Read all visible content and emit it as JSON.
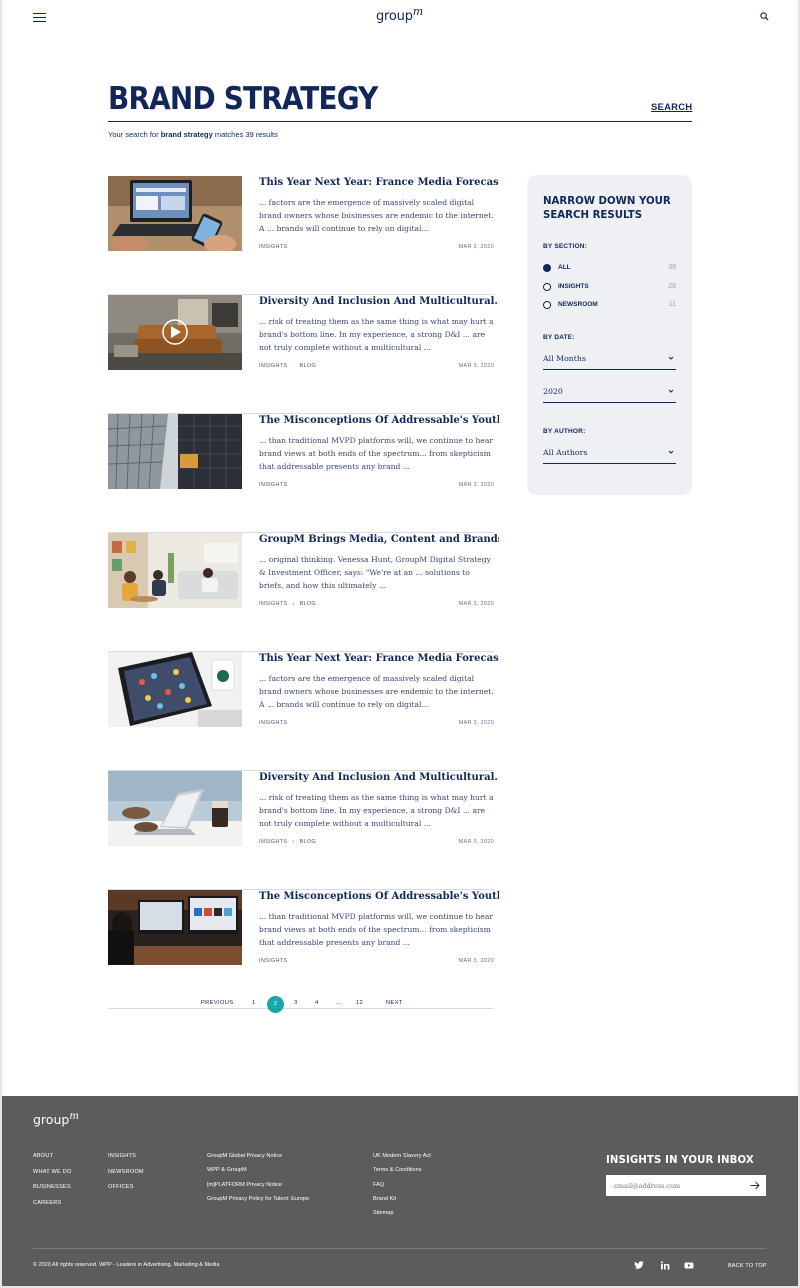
{
  "header": {
    "logo_text": "group",
    "logo_mark": "m"
  },
  "search": {
    "title": "BRAND STRATEGY",
    "search_link": "SEARCH",
    "result_prefix": "Your search for",
    "query": "brand strategy",
    "result_suffix": "matches 39 results"
  },
  "articles": [
    {
      "title": "This Year Next Year: France Media Forecasts",
      "excerpt": "... factors are the emergence of massively scaled digital brand owners whose businesses are endemic to the internet. A ... brands will continue to rely on digital...",
      "tags": [
        "INSIGHTS"
      ],
      "date": "MAR 3, 2020",
      "image": "laptop-phone-photo"
    },
    {
      "title": "Diversity And Inclusion And Multicultural...",
      "excerpt": "... risk of treating them as the same thing is what may hurt a brand's bottom line. In my experience, a strong D&I ... are not truly complete without a multicultural ...",
      "tags": [
        "INSIGHTS",
        "BLOG"
      ],
      "date": "MAR 3, 2020",
      "image": "living-room-video"
    },
    {
      "title": "The Misconceptions Of Addressable's Youth...",
      "excerpt": "... than traditional MVPD platforms will, we continue to hear brand views at both ends of the spectrum... from skepticism that addressable presents any brand ...",
      "tags": [
        "INSIGHTS"
      ],
      "date": "MAR 3, 2020",
      "image": "glass-building-photo"
    },
    {
      "title": "GroupM Brings Media, Content and Brands...",
      "excerpt": "... original thinking.    Venessa Hunt, GroupM Digital Strategy & Investment Officer, says: \"We're at an ... solutions to briefs, and how this ultimately ...",
      "tags": [
        "INSIGHTS",
        "BLOG"
      ],
      "date": "MAR 3, 2020",
      "image": "office-meeting-photo"
    },
    {
      "title": "This Year Next Year: France Media Forecasts",
      "excerpt": "... factors are the emergence of massively scaled digital brand owners whose businesses are endemic to the internet. A ... brands will continue to rely on digital...",
      "tags": [
        "INSIGHTS"
      ],
      "date": "MAR 3, 2020",
      "image": "tablet-coffee-photo"
    },
    {
      "title": "Diversity And Inclusion And Multicultural...",
      "excerpt": "... risk of treating them as the same thing is what may hurt a brand's bottom line. In my experience, a strong D&I ... are not truly complete without a multicultural ...",
      "tags": [
        "INSIGHTS",
        "BLOG"
      ],
      "date": "MAR 3, 2020",
      "image": "laptop-coffee-photo"
    },
    {
      "title": "The Misconceptions Of Addressable's Youth...",
      "excerpt": "... than traditional MVPD platforms will, we continue to hear brand views at both ends of the spectrum... from skepticism that addressable presents any brand ...",
      "tags": [
        "INSIGHTS"
      ],
      "date": "MAR 3, 2020",
      "image": "monitors-desk-photo"
    }
  ],
  "filters": {
    "heading": "NARROW DOWN YOUR SEARCH RESULTS",
    "section_label": "BY SECTION:",
    "sections": [
      {
        "label": "ALL",
        "count": "39",
        "selected": true
      },
      {
        "label": "INSIGHTS",
        "count": "28",
        "selected": false
      },
      {
        "label": "NEWSROOM",
        "count": "11",
        "selected": false
      }
    ],
    "date_label": "BY DATE:",
    "month_value": "All Months",
    "year_value": "2020",
    "author_label": "BY AUTHOR:",
    "author_value": "All Authors"
  },
  "pagination": {
    "previous": "PREVIOUS",
    "pages": [
      "1",
      "2",
      "3",
      "4",
      "...",
      "12"
    ],
    "current": "2",
    "next": "NEXT"
  },
  "footer": {
    "logo_text": "group",
    "logo_mark": "m",
    "col1": [
      "ABOUT",
      "WHAT WE DO",
      "BUSINESSES",
      "CAREERS"
    ],
    "col2": [
      "INSIGHTS",
      "NEWSROOM",
      "OFFICES"
    ],
    "col3": [
      "GroupM Global Privacy Notice",
      "WPP & GroupM",
      "[m]PLATFORM Privacy Notice",
      "GroupM Privacy Policy for Talent: Europe"
    ],
    "col4": [
      "UK Modern Slavery Act",
      "Terms & Conditions",
      "FAQ",
      "Brand Kit",
      "Sitemap"
    ],
    "inbox_title": "INSIGHTS IN YOUR INBOX",
    "email_placeholder": "email@address.com",
    "copyright": "© 2020 All rights reserved. WPP - Leaders in Advertising, Marketing & Media",
    "social": [
      "twitter-icon",
      "linkedin-icon",
      "youtube-icon"
    ],
    "back_to_top": "BACK TO TOP"
  },
  "colors": {
    "navy": "#13265a",
    "teal": "#17a9a9",
    "footer_bg": "#5c5c5c",
    "panel_bg": "#eef0f4"
  }
}
